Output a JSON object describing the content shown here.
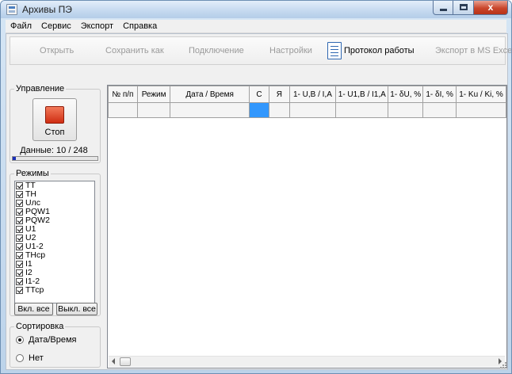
{
  "window": {
    "title": "Архивы ПЭ",
    "minimize": "",
    "maximize": "",
    "close": "x"
  },
  "menu": [
    "Файл",
    "Сервис",
    "Экспорт",
    "Справка"
  ],
  "toolbar": {
    "open": "Открыть",
    "save_as": "Сохранить как",
    "connect": "Подключение",
    "settings": "Настройки",
    "protocol": "Протокол работы",
    "export_excel": "Экспорт в MS Excel"
  },
  "control": {
    "title": "Управление",
    "stop_label": "Стоп",
    "data_label": "Данные: 10 / 248",
    "progress": 0.04
  },
  "modes": {
    "title": "Режимы",
    "items": [
      "ТТ",
      "ТН",
      "Uлс",
      "PQW1",
      "PQW2",
      "U1",
      "U2",
      "U1-2",
      "ТНср",
      "I1",
      "I2",
      "I1-2",
      "ТТср"
    ],
    "enable_all": "Вкл. все",
    "disable_all": "Выкл. все"
  },
  "sort": {
    "title": "Сортировка",
    "options": [
      "Дата/Время",
      "Нет"
    ],
    "selected": "Дата/Время"
  },
  "table": {
    "columns": [
      "№ п/п",
      "Режим",
      "Дата / Время",
      "С",
      "Я",
      "1- U,В / I,А",
      "1- U1,В / I1,А",
      "1- δU, %",
      "1- δI, %",
      "1- Ku / Ki, %"
    ]
  },
  "colors": {
    "selection": "#3297fd",
    "stop": "#d8341a",
    "progress": "#1a2fb8"
  }
}
